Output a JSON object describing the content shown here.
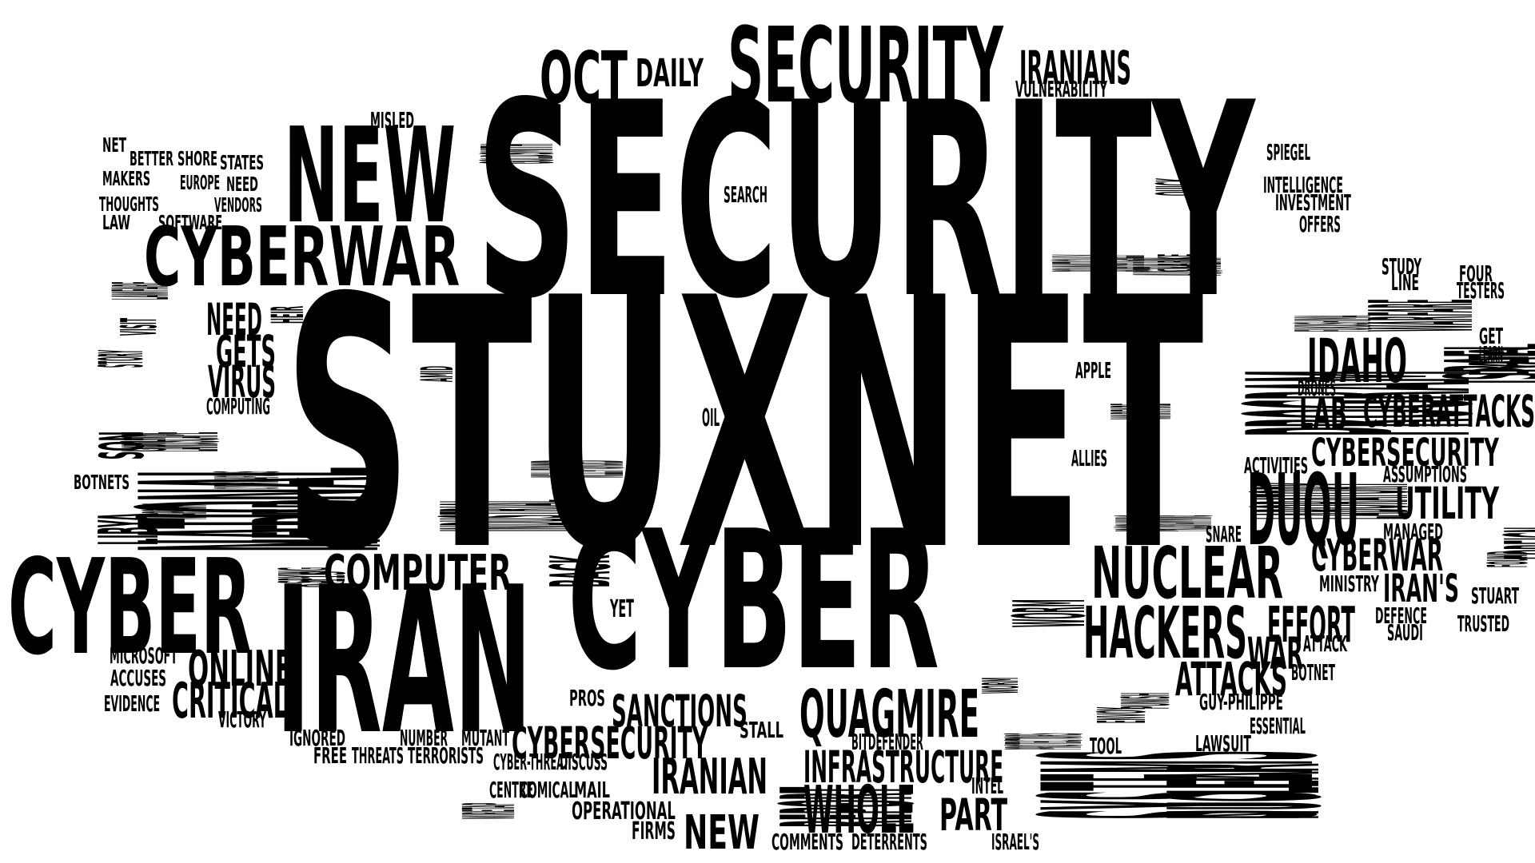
{
  "text_color": "#000000",
  "background": "#ffffff",
  "words": [
    {
      "text": "STUXNET"
    },
    {
      "text": "SECURITY"
    },
    {
      "text": "SECURITY"
    },
    {
      "text": "IRAN"
    },
    {
      "text": "CYBER"
    },
    {
      "text": "CYBER"
    },
    {
      "text": "NEW"
    },
    {
      "text": "CYBERWAR"
    },
    {
      "text": "NATIONAL"
    },
    {
      "text": "COMPUTER"
    },
    {
      "text": "NUCLEAR"
    },
    {
      "text": "NUCLEAR"
    },
    {
      "text": "SYSTEMS"
    },
    {
      "text": "PROGRAM"
    },
    {
      "text": "DUQU"
    },
    {
      "text": "HACKERS"
    },
    {
      "text": "QUAGMIRE"
    },
    {
      "text": "INFRASTRUCTURE"
    },
    {
      "text": "WHOLE"
    },
    {
      "text": "CYBERSECURITY"
    },
    {
      "text": "CYBERSECURITY"
    },
    {
      "text": "IRANIAN"
    },
    {
      "text": "SANCTIONS"
    },
    {
      "text": "REPORT"
    },
    {
      "text": "CRITICAL"
    },
    {
      "text": "ONLINE"
    },
    {
      "text": "IDAHO"
    },
    {
      "text": "ISRAEL"
    },
    {
      "text": "CYBERATTACKS"
    },
    {
      "text": "LAB"
    },
    {
      "text": "LABORATORY"
    },
    {
      "text": "UTILITY"
    },
    {
      "text": "FOREIGN"
    },
    {
      "text": "CYBERWAR"
    },
    {
      "text": "IRAN'S"
    },
    {
      "text": "EFFORT"
    },
    {
      "text": "WAR"
    },
    {
      "text": "ATTACKS"
    },
    {
      "text": "PART"
    },
    {
      "text": "OCT"
    },
    {
      "text": "DAILY"
    },
    {
      "text": "IRANIANS"
    },
    {
      "text": "VULNERABILITY"
    },
    {
      "text": "NEEDED"
    },
    {
      "text": "INDUSTRIAL"
    },
    {
      "text": "BACK"
    },
    {
      "text": "WORM"
    },
    {
      "text": "GETS"
    },
    {
      "text": "VIRUS"
    },
    {
      "text": "NEED"
    },
    {
      "text": "LIBYA"
    },
    {
      "text": "SON"
    },
    {
      "text": "WARFARE"
    },
    {
      "text": "DATA"
    },
    {
      "text": "NEW"
    },
    {
      "text": "OPERATIONAL"
    },
    {
      "text": "FIRMS"
    },
    {
      "text": "MISLED"
    },
    {
      "text": "NET"
    },
    {
      "text": "BETTER"
    },
    {
      "text": "SHORE"
    },
    {
      "text": "STATES"
    },
    {
      "text": "MAKERS"
    },
    {
      "text": "EUROPE"
    },
    {
      "text": "NEED"
    },
    {
      "text": "THOUGHTS"
    },
    {
      "text": "VENDORS"
    },
    {
      "text": "LAW"
    },
    {
      "text": "SOFTWARE"
    },
    {
      "text": "GOLDSMITH"
    },
    {
      "text": "LAWFARE"
    },
    {
      "text": "STORY"
    },
    {
      "text": "VISIT"
    },
    {
      "text": "LANDSCAPE"
    },
    {
      "text": "HEIR"
    },
    {
      "text": "COMPUTING"
    },
    {
      "text": "GUILTY"
    },
    {
      "text": "CYBERWEAPON'S"
    },
    {
      "text": "BOTNETS"
    },
    {
      "text": "WEAPONRY"
    },
    {
      "text": "SPYING"
    },
    {
      "text": "9/11S"
    },
    {
      "text": "AMID"
    },
    {
      "text": "WELL-FUNDED"
    },
    {
      "text": "MICROSOFT"
    },
    {
      "text": "ACCUSES"
    },
    {
      "text": "EVIDENCE"
    },
    {
      "text": "VICTORY"
    },
    {
      "text": "IGNORED"
    },
    {
      "text": "FREE"
    },
    {
      "text": "THREATS"
    },
    {
      "text": "NUMBER"
    },
    {
      "text": "TERRORISTS"
    },
    {
      "text": "MUTANT"
    },
    {
      "text": "CYBER-THREAT"
    },
    {
      "text": "DISCUSS"
    },
    {
      "text": "WIRETAP"
    },
    {
      "text": "CENTRE"
    },
    {
      "text": "COMICAL"
    },
    {
      "text": "MAIL"
    },
    {
      "text": "PROS"
    },
    {
      "text": "YET"
    },
    {
      "text": "STALL"
    },
    {
      "text": "BITDEFENDER"
    },
    {
      "text": "COMMENTS"
    },
    {
      "text": "DETERRENTS"
    },
    {
      "text": "INTEL"
    },
    {
      "text": "ISRAEL'S"
    },
    {
      "text": "SEARCH"
    },
    {
      "text": "OIL"
    },
    {
      "text": "DRAMATICALLY"
    },
    {
      "text": "AUSTRALIAN"
    },
    {
      "text": "QUICK"
    },
    {
      "text": "CLARKE"
    },
    {
      "text": "APPLE"
    },
    {
      "text": "WARFARE"
    },
    {
      "text": "ALLIES"
    },
    {
      "text": "PROGRAMMING"
    },
    {
      "text": "SNARE"
    },
    {
      "text": "SPIEGEL"
    },
    {
      "text": "INTELLIGENCE"
    },
    {
      "text": "INVESTMENT"
    },
    {
      "text": "OFFERS"
    },
    {
      "text": "FUKUSHIMA"
    },
    {
      "text": "STUDY"
    },
    {
      "text": "LINE"
    },
    {
      "text": "FOUR"
    },
    {
      "text": "TESTERS"
    },
    {
      "text": "GET"
    },
    {
      "text": "LEARN"
    },
    {
      "text": "DRONES"
    },
    {
      "text": "ACTIVITIES"
    },
    {
      "text": "ASSUMPTIONS"
    },
    {
      "text": "MANAGED"
    },
    {
      "text": "FOUND"
    },
    {
      "text": "MINISTRY"
    },
    {
      "text": "STUART"
    },
    {
      "text": "DEFENCE"
    },
    {
      "text": "SAUDI"
    },
    {
      "text": "TRUSTED"
    },
    {
      "text": "ATTACK"
    },
    {
      "text": "BOTNET"
    },
    {
      "text": "GUY-PHILIPPE"
    },
    {
      "text": "ESSENTIAL"
    },
    {
      "text": "LAWSUIT"
    },
    {
      "text": "TOOL"
    },
    {
      "text": "ENVOY"
    },
    {
      "text": "PUNISH"
    },
    {
      "text": "WORM"
    },
    {
      "text": "PROTECTORS"
    }
  ]
}
